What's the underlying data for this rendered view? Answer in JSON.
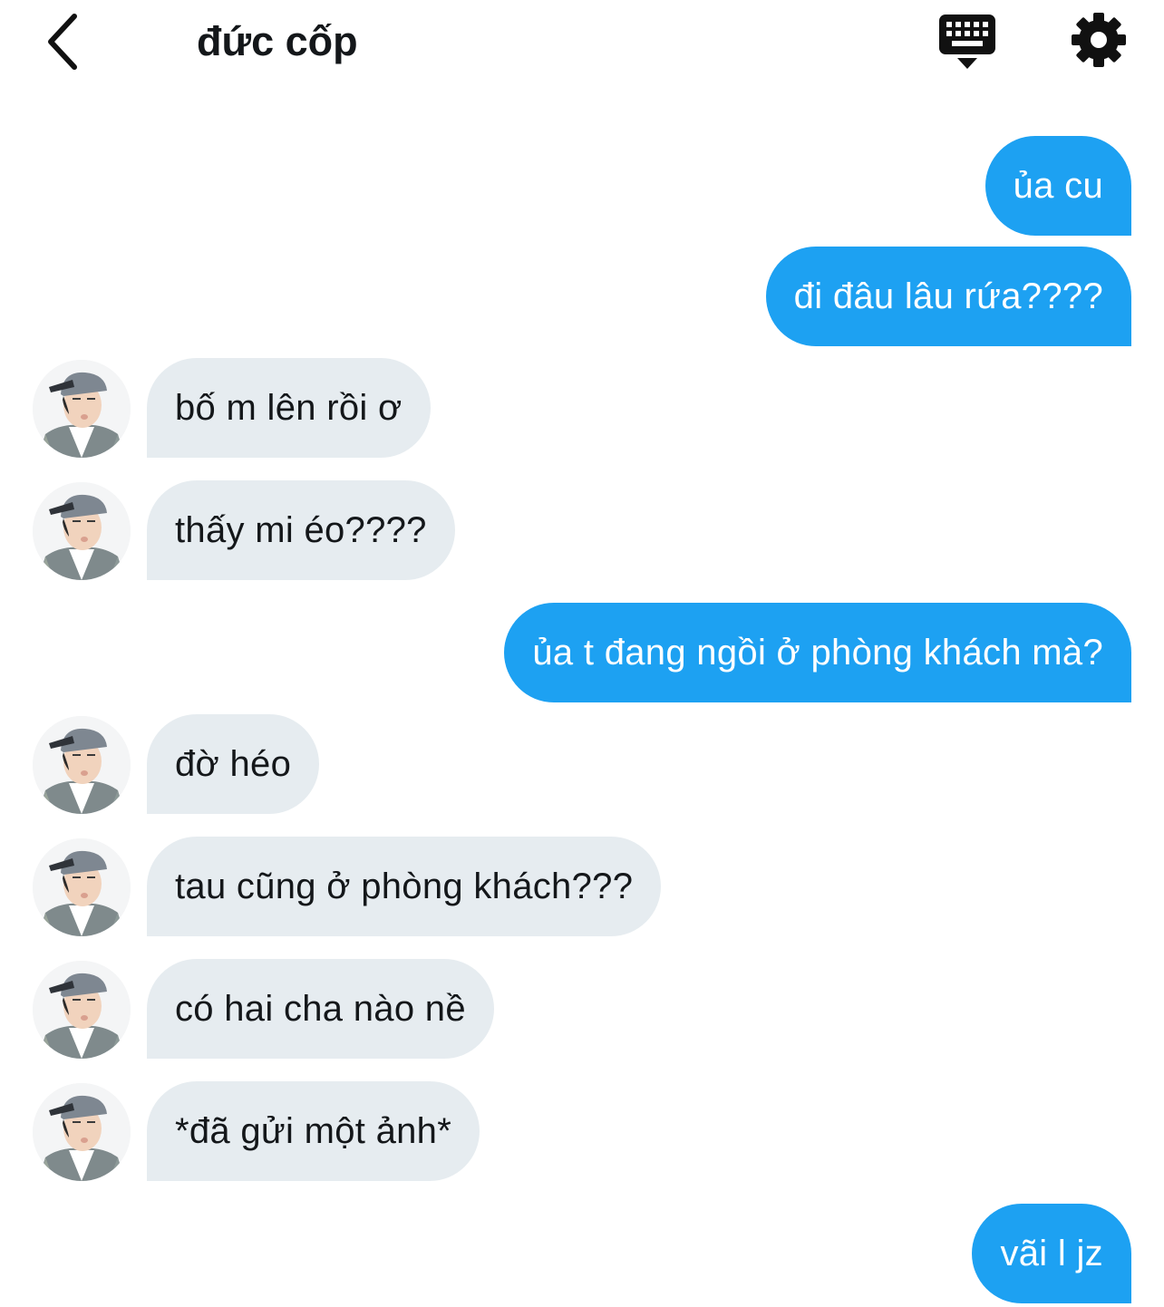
{
  "header": {
    "title": "đức cốp",
    "back_icon": "chevron-left-icon",
    "keyboard_icon": "keyboard-icon",
    "settings_icon": "gear-icon"
  },
  "colors": {
    "sent_bubble": "#1da1f2",
    "received_bubble": "#e6ecf0",
    "text_dark": "#14171a"
  },
  "messages": [
    {
      "direction": "sent",
      "text": "ủa cu"
    },
    {
      "direction": "sent",
      "text": "đi đâu lâu rứa????"
    },
    {
      "direction": "received",
      "text": "bố m lên rồi ơ"
    },
    {
      "direction": "received",
      "text": "thấy mi éo????"
    },
    {
      "direction": "sent",
      "text": "ủa t đang ngồi ở phòng khách mà?"
    },
    {
      "direction": "received",
      "text": "đờ héo"
    },
    {
      "direction": "received",
      "text": "tau cũng ở phòng khách???"
    },
    {
      "direction": "received",
      "text": "có hai cha nào nề"
    },
    {
      "direction": "received",
      "text": "*đã gửi một ảnh*"
    },
    {
      "direction": "sent",
      "text": "vãi l jz"
    }
  ]
}
